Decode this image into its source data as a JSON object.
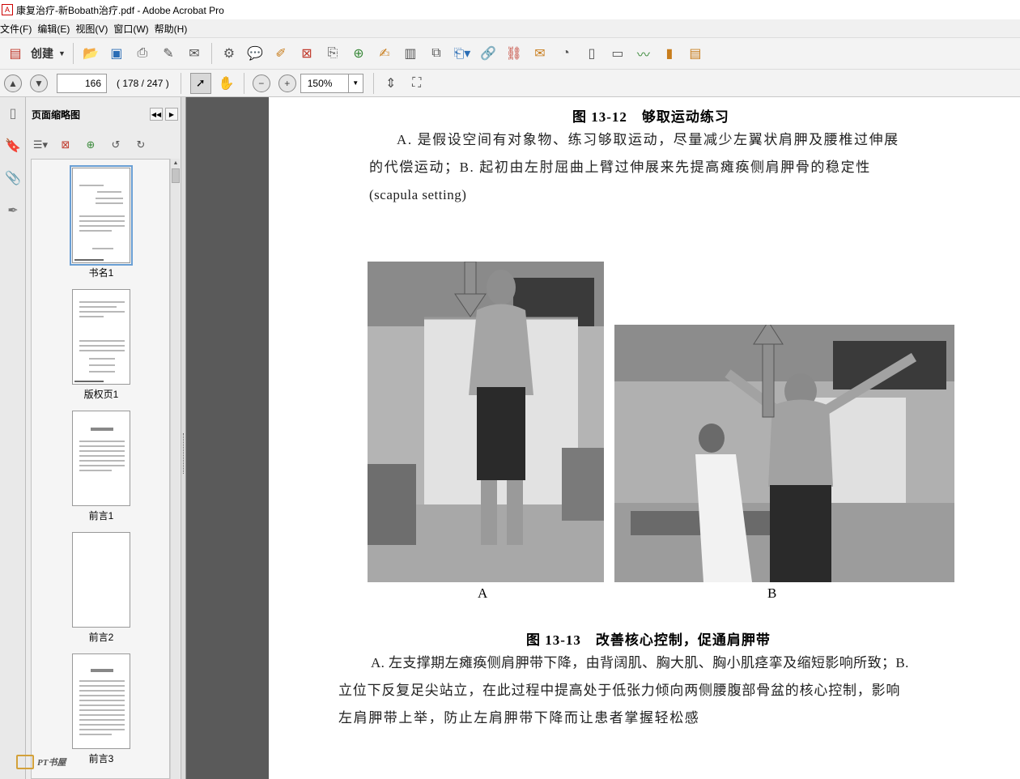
{
  "window": {
    "title": "康复治疗-新Bobath治疗.pdf - Adobe Acrobat Pro"
  },
  "menu": [
    "文件(F)",
    "编辑(E)",
    "视图(V)",
    "窗口(W)",
    "帮助(H)"
  ],
  "toolbar": {
    "create_label": "创建"
  },
  "nav": {
    "page_value": "166",
    "page_count": "( 178 / 247 )",
    "zoom_value": "150%"
  },
  "panel": {
    "title": "页面缩略图",
    "thumbnails": [
      {
        "label": "书名1"
      },
      {
        "label": "版权页1"
      },
      {
        "label": "前言1"
      },
      {
        "label": "前言2"
      },
      {
        "label": "前言3"
      }
    ]
  },
  "document": {
    "caption_top": "图 13-12　够取运动练习",
    "para_top": [
      "A. 是假设空间有对象物、练习够取运动，尽量减少左翼状肩胛及腰椎过伸展",
      "的代偿运动；B. 起初由左肘屈曲上臂过伸展来先提高瘫痪侧肩胛骨的稳定性",
      "(scapula setting)"
    ],
    "photo_a_label": "A",
    "photo_b_label": "B",
    "caption_bottom": "图 13-13　改善核心控制，促通肩胛带",
    "para_bottom": [
      "A. 左支撑期左瘫痪侧肩胛带下降，由背阔肌、胸大肌、胸小肌痉挛及缩短影响所致；B.",
      "立位下反复足尖站立，在此过程中提高处于低张力倾向两侧腰腹部骨盆的核心控制，影响",
      "左肩胛带上举，防止左肩胛带下降而让患者掌握轻松感"
    ]
  },
  "watermark": {
    "text": "PT书屋"
  }
}
